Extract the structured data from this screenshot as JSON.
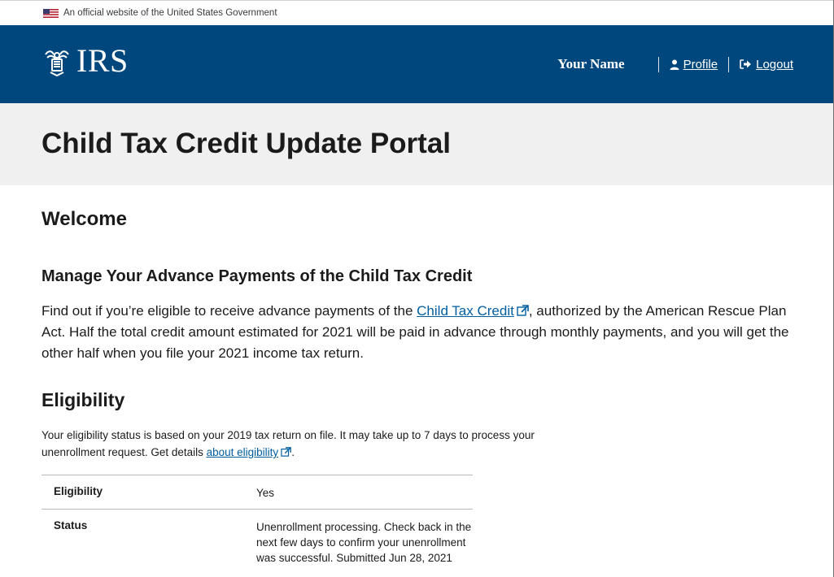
{
  "gov_banner": {
    "text": "An official website of the United States Government"
  },
  "header": {
    "logo_text": "IRS",
    "user_name": "Your Name",
    "profile_label": "Profile",
    "logout_label": "Logout"
  },
  "page": {
    "title": "Child Tax Credit Update Portal"
  },
  "welcome": {
    "heading": "Welcome"
  },
  "manage": {
    "heading": "Manage Your Advance Payments of the Child Tax Credit",
    "intro_before": "Find out if you’re eligible to receive advance payments of the ",
    "intro_link": "Child Tax Credit",
    "intro_after": ", authorized by the American Rescue Plan Act. Half the total credit amount estimated for 2021 will be paid in advance through monthly payments, and you will get the other half when you file your 2021 income tax return."
  },
  "eligibility": {
    "heading": "Eligibility",
    "text_before": "Your eligibility status is based on your 2019 tax return on file. It may take up to 7 days to process your unenrollment request. Get details ",
    "link": "about eligibility",
    "text_after": ".",
    "rows": [
      {
        "label": "Eligibility",
        "value": "Yes"
      },
      {
        "label": "Status",
        "value": "Unenrollment processing. Check back in the next few days to confirm your unenrollment was successful. Submitted Jun 28, 2021"
      }
    ]
  },
  "colors": {
    "header_bg": "#00477d",
    "title_band_bg": "#f0f0f0",
    "link": "#005ea2"
  },
  "icons": [
    "us-flag-icon",
    "irs-eagle-icon",
    "user-icon",
    "logout-icon",
    "external-link-icon"
  ]
}
